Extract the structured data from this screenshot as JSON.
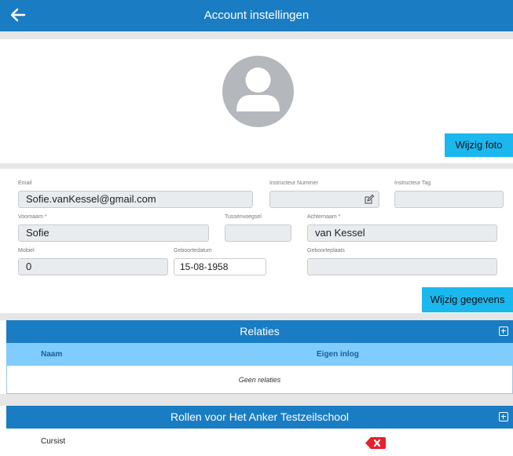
{
  "header": {
    "title": "Account instellingen",
    "back_icon": "arrow-left-icon"
  },
  "photo": {
    "button_label": "Wijzig foto",
    "avatar_icon": "user-silhouette-icon"
  },
  "form": {
    "email_label": "Email",
    "email_value": "Sofie.vanKessel@gmail.com",
    "instructor_number_label": "Instructeur Nummer",
    "instructor_number_value": "",
    "instructor_tag_label": "Instructeur Tag",
    "instructor_tag_value": "",
    "first_name_label": "Voornaam *",
    "first_name_value": "Sofie",
    "infix_label": "Tussenvoegsel",
    "infix_value": "",
    "last_name_label": "Achternaam *",
    "last_name_value": "van Kessel",
    "mobile_label": "Mobiel",
    "mobile_value": "0",
    "birthdate_label": "Geboortedatum",
    "birthdate_value": "15-08-1958",
    "birthplace_label": "Geboorteplaats",
    "birthplace_value": "",
    "save_button_label": "Wijzig gegevens"
  },
  "relations": {
    "title": "Relaties",
    "col_name": "Naam",
    "col_own_login": "Eigen inlog",
    "empty_text": "Geen relaties"
  },
  "roles": {
    "title": "Rollen voor Het Anker Testzeilschool",
    "items": [
      {
        "label": "Cursist"
      }
    ]
  },
  "colors": {
    "primary": "#1a7dc4",
    "accent_button": "#1ab8ee",
    "table_header": "#80ccff",
    "delete": "#e8202a"
  }
}
